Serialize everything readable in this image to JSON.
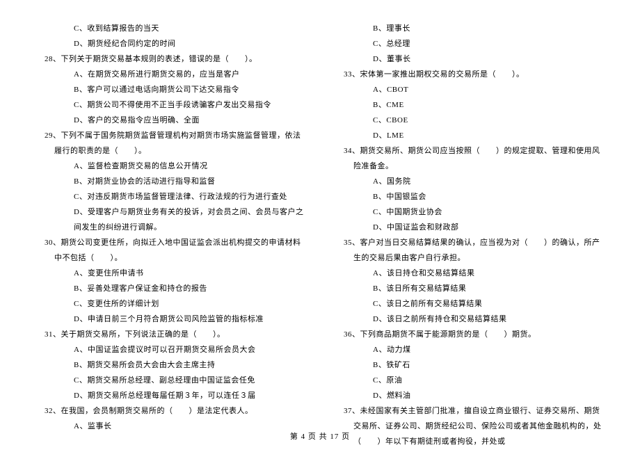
{
  "leftColumn": {
    "orphanOptions": [
      "C、收到结算报告的当天",
      "D、期货经纪合同约定的时间"
    ],
    "questions": [
      {
        "num": "28、",
        "text": "下列关于期货交易基本规则的表述，错误的是（　　）。",
        "options": [
          "A、在期货交易所进行期货交易的，应当是客户",
          "B、客户可以通过电话向期货公司下达交易指令",
          "C、期货公司不得使用不正当手段诱骗客户发出交易指令",
          "D、客户的交易指令应当明确、全面"
        ]
      },
      {
        "num": "29、",
        "text": "下列不属于国务院期货监督管理机构对期货市场实施监督管理，依法履行的职责的是（　　）。",
        "options": [
          "A、监督检查期货交易的信息公开情况",
          "B、对期货业协会的活动进行指导和监督",
          "C、对违反期货市场监督管理法律、行政法规的行为进行查处",
          "D、受理客户与期货业务有关的投诉，对会员之间、会员与客户之间发生的纠纷进行调解。"
        ]
      },
      {
        "num": "30、",
        "text": "期货公司变更住所，向拟迁入地中国证监会派出机构提交的申请材料中不包括（　　）。",
        "options": [
          "A、变更住所申请书",
          "B、妥善处理客户保证金和持仓的报告",
          "C、变更住所的详细计划",
          "D、申请日前三个月符合期货公司风险监管的指标标准"
        ]
      },
      {
        "num": "31、",
        "text": "关于期货交易所，下列说法正确的是（　　）。",
        "options": [
          "A、中国证监会提议时可以召开期货交易所会员大会",
          "B、期货交易所会员大会由大会主席主持",
          "C、期货交易所总经理、副总经理由中国证监会任免",
          "D、期货交易所总经理每届任期３年，可以连任３届"
        ]
      },
      {
        "num": "32、",
        "text": "在我国，会员制期货交易所的（　　）是法定代表人。",
        "options": [
          "A、监事长"
        ]
      }
    ]
  },
  "rightColumn": {
    "orphanOptions": [
      "B、理事长",
      "C、总经理",
      "D、董事长"
    ],
    "questions": [
      {
        "num": "33、",
        "text": "宋体第一家推出期权交易的交易所是（　　）。",
        "options": [
          "A、CBOT",
          "B、CME",
          "C、CBOE",
          "D、LME"
        ]
      },
      {
        "num": "34、",
        "text": "期货交易所、期货公司应当按照（　　）的规定提取、管理和使用风险准备金。",
        "options": [
          "A、国务院",
          "B、中国银监会",
          "C、中国期货业协会",
          "D、中国证监会和财政部"
        ]
      },
      {
        "num": "35、",
        "text": "客户对当日交易结算结果的确认，应当视为对（　　）的确认，所产生的交易后果由客户自行承担。",
        "options": [
          "A、该日持仓和交易结算结果",
          "B、该日所有交易结算结果",
          "C、该日之前所有交易结算结果",
          "D、该日之前所有持仓和交易结算结果"
        ]
      },
      {
        "num": "36、",
        "text": "下列商品期货不属于能源期货的是（　　）期货。",
        "options": [
          "A、动力煤",
          "B、铁矿石",
          "C、原油",
          "D、燃料油"
        ]
      },
      {
        "num": "37、",
        "text": "未经国家有关主管部门批准，擅自设立商业银行、证券交易所、期货交易所、证券公司、期货经纪公司、保险公司或者其他金融机构的，处（　　）年以下有期徒刑或者拘役，并处或",
        "options": []
      }
    ]
  },
  "footer": "第 4 页 共 17 页"
}
